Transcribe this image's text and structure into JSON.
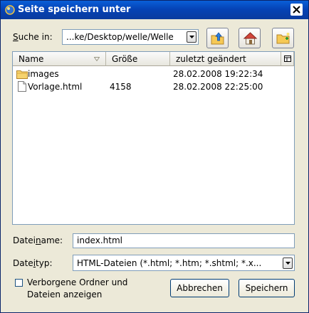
{
  "window": {
    "title": "Seite speichern unter"
  },
  "location": {
    "label_prefix": "",
    "label_key": "S",
    "label_rest": "uche in:",
    "path": "...ke/Desktop/welle/Welle"
  },
  "toolbar": [
    {
      "name": "up-folder-button",
      "icon": "folder-up-icon"
    },
    {
      "name": "home-button",
      "icon": "home-icon"
    },
    {
      "name": "new-folder-button",
      "icon": "new-folder-icon"
    }
  ],
  "file_list": {
    "columns": [
      {
        "label": "Name"
      },
      {
        "label": "Größe"
      },
      {
        "label": "zuletzt geändert"
      }
    ],
    "rows": [
      {
        "type": "folder",
        "icon": "folder-icon",
        "name": "images",
        "size": "",
        "modified": "28.02.2008 19:22:34"
      },
      {
        "type": "file",
        "icon": "file-icon",
        "name": "Vorlage.html",
        "size": "4158",
        "modified": "28.02.2008 22:25:00"
      }
    ]
  },
  "filename": {
    "label_prefix": "Datei",
    "label_key": "n",
    "label_rest": "ame:",
    "value": "index.html"
  },
  "filetype": {
    "label_prefix": "Date",
    "label_key": "i",
    "label_rest": "typ:",
    "value": "HTML-Dateien (*.html; *.htm; *.shtml; *.x..."
  },
  "options": {
    "show_hidden_line1": "Verborgene Ordner und",
    "show_hidden_line2": "Dateien anzeigen"
  },
  "buttons": {
    "cancel": "Abbrechen",
    "save": "Speichern"
  }
}
